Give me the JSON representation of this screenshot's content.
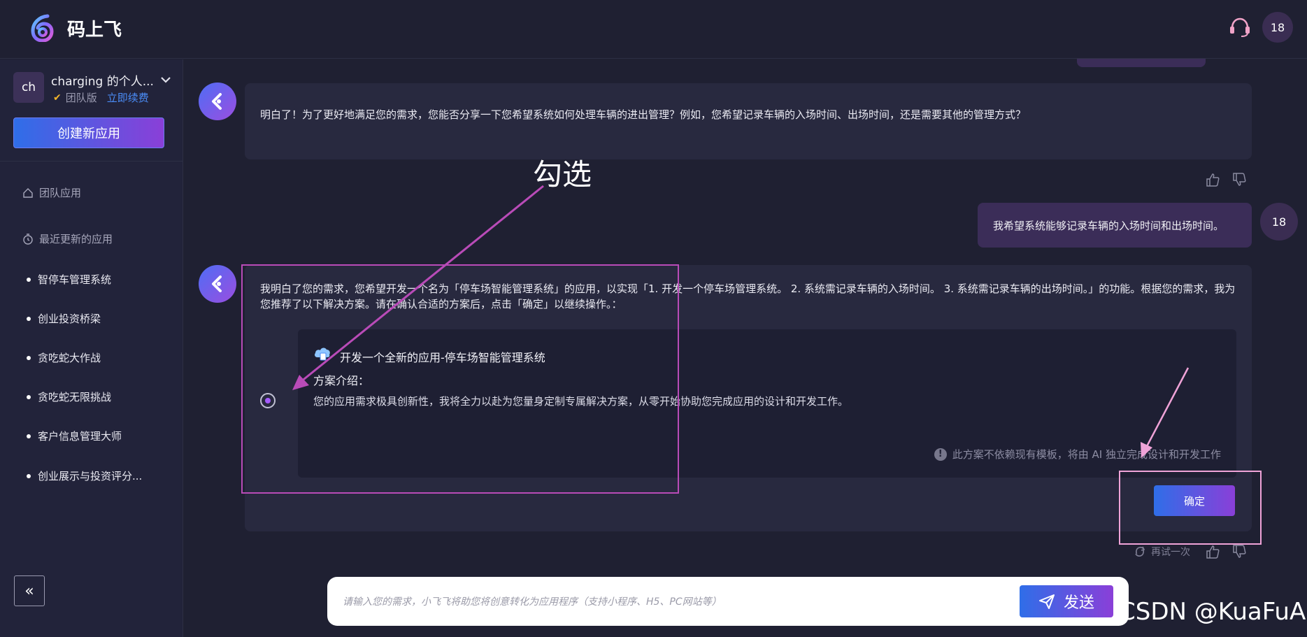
{
  "header": {
    "brand": "码上飞",
    "user_avatar": "18",
    "support_icon": "headset-icon"
  },
  "sidebar": {
    "workspace_avatar": "ch",
    "workspace_name": "charging 的个人...",
    "plan_label": "团队版",
    "renew_link": "立即续费",
    "create_button": "创建新应用",
    "nav": {
      "team_apps": "团队应用",
      "recent_apps": "最近更新的应用"
    },
    "apps": [
      "智停车管理系统",
      "创业投资桥梁",
      "贪吃蛇大作战",
      "贪吃蛇无限挑战",
      "客户信息管理大师",
      "创业展示与投资评分..."
    ],
    "collapse_icon": "«"
  },
  "chat": {
    "bot_message_1": "明白了！为了更好地满足您的需求，您能否分享一下您希望系统如何处理车辆的进出管理？例如，您希望记录车辆的入场时间、出场时间，还是需要其他的管理方式？",
    "user_message": "我希望系统能够记录车辆的入场时间和出场时间。",
    "user_avatar": "18",
    "bot_message_2": "我明白了您的需求，您希望开发一个名为「停车场智能管理系统」的应用，以实现「1. 开发一个停车场管理系统。 2. 系统需记录车辆的入场时间。 3. 系统需记录车辆的出场时间。」的功能。根据您的需求，我为您推荐了以下解决方案。请在确认合适的方案后，点击「确定」以继续操作。：",
    "plan": {
      "title": "开发一个全新的应用-停车场智能管理系统",
      "intro_label": "方案介绍：",
      "description": "您的应用需求极具创新性，我将全力以赴为您量身定制专属解决方案，从零开始协助您完成应用的设计和开发工作。",
      "note": "此方案不依赖现有模板，将由 AI 独立完成设计和开发工作",
      "selected": true
    },
    "confirm_button": "确定",
    "retry_label": "再试一次"
  },
  "input": {
    "placeholder": "请输入您的需求，小飞飞将助您将创意转化为应用程序（支持小程序、H5、PC网站等）",
    "send_button": "发送"
  },
  "annotations": {
    "label": "勾选"
  },
  "watermark": "CSDN @KuaFuAI",
  "colors": {
    "background": "#1f2032",
    "sidebar": "#22233a",
    "bubble": "#28293f",
    "user_bubble": "#3b2d58",
    "accent_start": "#2f6ee8",
    "accent_end": "#8a3fd8",
    "annotation_purple": "#b94bb8",
    "annotation_pink": "#f0a3d8"
  }
}
